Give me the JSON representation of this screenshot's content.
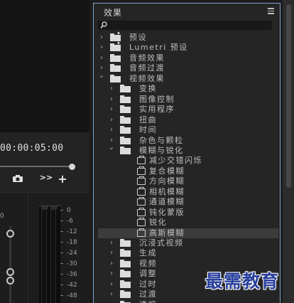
{
  "monitor": {
    "timecode": "00:00:05:00",
    "controls": {
      "camera_icon": "camera-icon",
      "more_label": ">>",
      "add_label": "+"
    }
  },
  "meters": {
    "left_mark": "0",
    "scale": [
      "0",
      "-6",
      "-12",
      "-18",
      "-24",
      "-30",
      "-36",
      "-42",
      "-48"
    ]
  },
  "effects": {
    "title": "效果",
    "search": {
      "value": "",
      "placeholder": ""
    },
    "tree": [
      {
        "label": "预设",
        "level": 0,
        "expanded": false,
        "icon": "star-bin"
      },
      {
        "label": "Lumetri 预设",
        "level": 0,
        "expanded": false,
        "icon": "star-bin"
      },
      {
        "label": "音频效果",
        "level": 0,
        "expanded": false,
        "icon": "bin"
      },
      {
        "label": "音频过渡",
        "level": 0,
        "expanded": false,
        "icon": "bin"
      },
      {
        "label": "视频效果",
        "level": 0,
        "expanded": true,
        "icon": "bin"
      },
      {
        "label": "变换",
        "level": 1,
        "expanded": false,
        "icon": "bin"
      },
      {
        "label": "图像控制",
        "level": 1,
        "expanded": false,
        "icon": "bin"
      },
      {
        "label": "实用程序",
        "level": 1,
        "expanded": false,
        "icon": "bin"
      },
      {
        "label": "扭曲",
        "level": 1,
        "expanded": false,
        "icon": "bin"
      },
      {
        "label": "时间",
        "level": 1,
        "expanded": false,
        "icon": "bin"
      },
      {
        "label": "杂色与颗粒",
        "level": 1,
        "expanded": false,
        "icon": "bin"
      },
      {
        "label": "模糊与锐化",
        "level": 1,
        "expanded": true,
        "icon": "bin"
      },
      {
        "label": "减少交错闪烁",
        "level": 2,
        "icon": "effect"
      },
      {
        "label": "复合模糊",
        "level": 2,
        "icon": "effect"
      },
      {
        "label": "方向模糊",
        "level": 2,
        "icon": "effect"
      },
      {
        "label": "相机模糊",
        "level": 2,
        "icon": "effect"
      },
      {
        "label": "通道模糊",
        "level": 2,
        "icon": "effect"
      },
      {
        "label": "钝化蒙版",
        "level": 2,
        "icon": "effect"
      },
      {
        "label": "锐化",
        "level": 2,
        "icon": "effect"
      },
      {
        "label": "高斯模糊",
        "level": 2,
        "icon": "effect",
        "selected": true
      },
      {
        "label": "沉浸式视频",
        "level": 1,
        "expanded": false,
        "icon": "bin"
      },
      {
        "label": "生成",
        "level": 1,
        "expanded": false,
        "icon": "bin"
      },
      {
        "label": "视频",
        "level": 1,
        "expanded": false,
        "icon": "bin"
      },
      {
        "label": "调整",
        "level": 1,
        "expanded": false,
        "icon": "bin"
      },
      {
        "label": "过时",
        "level": 1,
        "expanded": false,
        "icon": "bin"
      },
      {
        "label": "过渡",
        "level": 1,
        "expanded": false,
        "icon": "bin"
      },
      {
        "label": "透视",
        "level": 1,
        "expanded": false,
        "icon": "bin"
      }
    ]
  },
  "watermark": "最需教育",
  "colors": {
    "panel_border": "#7fa2cf",
    "selected_row": "#3c3c3c",
    "watermark": "#2a3f9c"
  }
}
